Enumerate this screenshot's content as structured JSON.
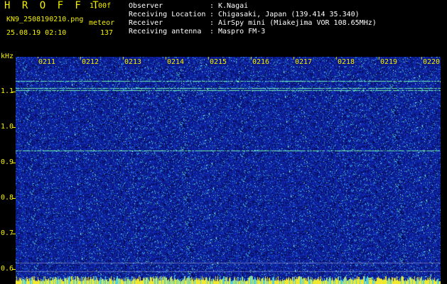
{
  "header": {
    "app_title": "H R O F F T",
    "version": "1.00f",
    "file_name": "KN9_2508190210.png",
    "mode_label": "meteor",
    "datetime": "25.08.19 02:10",
    "count": "137"
  },
  "meta": [
    {
      "key": "Observer",
      "sep": ":",
      "value": "K.Nagai"
    },
    {
      "key": "Receiving Location",
      "sep": ":",
      "value": "Chigasaki, Japan (139.414 35.340)"
    },
    {
      "key": "Receiver",
      "sep": ":",
      "value": "AirSpy mini (Miakejima VOR 108.65MHz)"
    },
    {
      "key": "Receiving antenna",
      "sep": ":",
      "value": "Maspro FM-3"
    }
  ],
  "axis": {
    "y_unit": "kHz",
    "y_ticks": [
      "1.1",
      "1.0",
      "0.9",
      "0.8",
      "0.7",
      "0.6"
    ],
    "x_ticks": [
      "0211",
      "0212",
      "0213",
      "0214",
      "0215",
      "0216",
      "0217",
      "0218",
      "0219",
      "0220"
    ]
  },
  "colors": {
    "background": "#0a1a8a",
    "noise_low": "#1530c8",
    "noise_mid": "#2a9ad8",
    "noise_high": "#7ff0d8",
    "signal_line": "#6ff0b0",
    "label_yellow": "#f4f000",
    "bottom_strip": "#f0e830"
  }
}
